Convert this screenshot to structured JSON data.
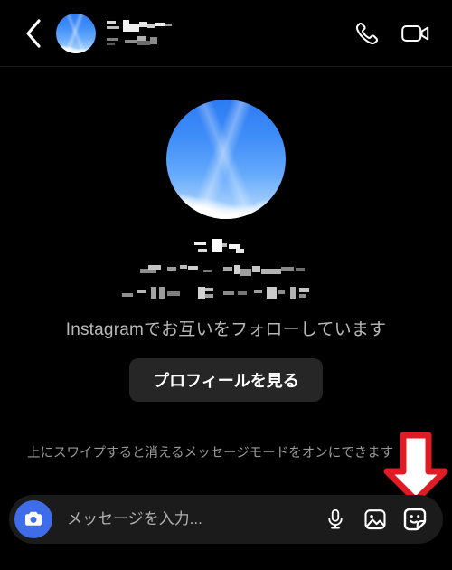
{
  "header": {
    "back_icon": "chevron-left-icon",
    "avatar_alt": "blue-sky-clouds-avatar",
    "name_censored": "",
    "handle_censored": "",
    "call_icon": "phone-icon",
    "video_icon": "video-camera-icon"
  },
  "profile": {
    "avatar_alt": "blue-sky-clouds-avatar",
    "name_censored": "",
    "handle_censored": "",
    "meta_censored": "",
    "mutual_follow_text": "Instagramでお互いをフォローしています",
    "view_profile_label": "プロフィールを見る"
  },
  "hint": {
    "swipe_text": "上にスワイプすると消えるメッセージモードをオンにできます"
  },
  "annotation": {
    "arrow_icon": "down-arrow-annotation",
    "arrow_fill": "#ffffff",
    "arrow_stroke": "#e01b24"
  },
  "composer": {
    "camera_icon": "camera-icon",
    "camera_button_color": "#3f6ce8",
    "input_value": "",
    "input_placeholder": "メッセージを入力...",
    "mic_icon": "microphone-icon",
    "gallery_icon": "photo-gallery-icon",
    "sticker_icon": "sticker-smiley-icon"
  },
  "theme": {
    "background": "#000000",
    "surface": "#1b1b1b",
    "button_surface": "#262626",
    "text_primary": "#ffffff",
    "text_secondary": "#b9b9b9"
  }
}
